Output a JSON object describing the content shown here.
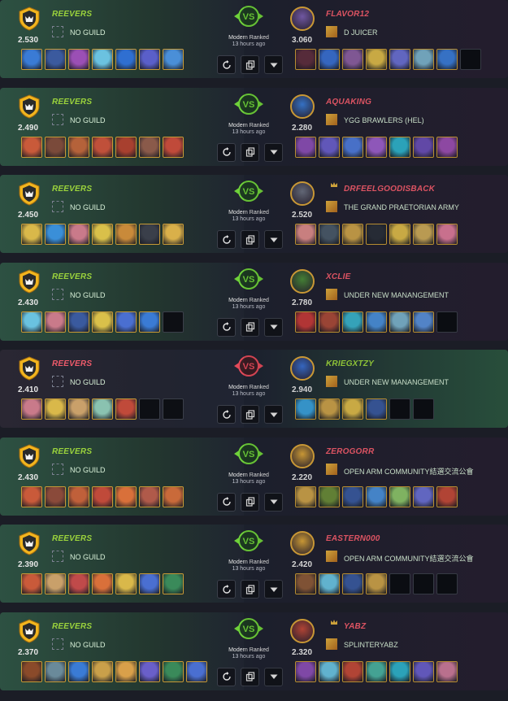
{
  "player": {
    "name": "REEVERS",
    "guild": "NO GUILD"
  },
  "battles": [
    {
      "result": "win",
      "player_rating": "2.530",
      "opponent": {
        "name": "FLAVOR12",
        "rating": "3.060",
        "guild": "D JUICER",
        "crown": false,
        "avatar_color": "#7a5fb0"
      },
      "mode": "Modern Ranked",
      "time": "13 hours ago",
      "player_cards": [
        "#3a7bd5",
        "#3b5a9e",
        "#9b4fb5",
        "#6bc2e0",
        "#2f6fd1",
        "#5a5fc9",
        "#4a8fd8"
      ],
      "opponent_cards": [
        "#5e2f3f",
        "#3a6fd0",
        "#8a5fa0",
        "#d9b84a",
        "#6a6fd1",
        "#7ab0c9",
        "#3b7bd5",
        "empty"
      ]
    },
    {
      "result": "win",
      "player_rating": "2.490",
      "opponent": {
        "name": "AQUAKING",
        "rating": "2.280",
        "guild": "YGG BRAWLERS (HEL)",
        "crown": false,
        "avatar_color": "#3a7bd5"
      },
      "mode": "Modern Ranked",
      "time": "13 hours ago",
      "player_cards": [
        "#c95a3a",
        "#7a4a3a",
        "#b5623a",
        "#c0503a",
        "#a8402f",
        "#8a5a4a",
        "#c04a3a"
      ],
      "opponent_cards": [
        "#8a4fb5",
        "#6a5fc9",
        "#4f7ad8",
        "#9b5fc9",
        "#2fb0c9",
        "#6a4fb5",
        "#9a4fb0"
      ]
    },
    {
      "result": "win",
      "player_rating": "2.450",
      "opponent": {
        "name": "DRFEELGOODISBACK",
        "rating": "2.520",
        "guild": "THE GRAND PRAETORIAN ARMY",
        "crown": true,
        "avatar_color": "#6a7080"
      },
      "mode": "Modern Ranked",
      "time": "13 hours ago",
      "player_cards": [
        "#d9b84a",
        "#3a8fd8",
        "#c97a8a",
        "#d9c04a",
        "#c98a3a",
        "#3a3f4a",
        "#d9b04a"
      ],
      "opponent_cards": [
        "#d98a8a",
        "#4a5a6a",
        "#c9a04a",
        "#2a2f3a",
        "#d9b84a",
        "#c9a85a",
        "#d97a9a"
      ]
    },
    {
      "result": "win",
      "player_rating": "2.430",
      "opponent": {
        "name": "XCLIE",
        "rating": "2.780",
        "guild": "UNDER NEW MANANGEMENT",
        "crown": false,
        "avatar_color": "#4a8a3a"
      },
      "mode": "Modern Ranked",
      "time": "13 hours ago",
      "player_cards": [
        "#6ac2e0",
        "#c97a8a",
        "#3a5a9e",
        "#d9c04a",
        "#4a6fd1",
        "#3a7bd5",
        "empty"
      ],
      "opponent_cards": [
        "#c03a3a",
        "#a84a3a",
        "#3ab0c9",
        "#4a8fd8",
        "#7ab0c9",
        "#5a8fd8",
        "empty"
      ]
    },
    {
      "result": "loss",
      "player_rating": "2.410",
      "opponent": {
        "name": "KRIEGXTZY",
        "rating": "2.940",
        "guild": "UNDER NEW MANANGEMENT",
        "crown": false,
        "avatar_color": "#3a6fd0"
      },
      "mode": "Modern Ranked",
      "time": "13 hours ago",
      "player_cards": [
        "#c97a8a",
        "#d9b84a",
        "#c9a06a",
        "#8ac2b0",
        "#c04a3a",
        "empty",
        "empty"
      ],
      "opponent_cards": [
        "#3a9fd8",
        "#c9a04a",
        "#d9b84a",
        "#3a5a9e",
        "empty",
        "empty"
      ]
    },
    {
      "result": "win",
      "player_rating": "2.430",
      "opponent": {
        "name": "ZEROGORR",
        "rating": "2.220",
        "guild": "OPEN ARM COMMUNITY結選交流公會",
        "crown": false,
        "avatar_color": "#d9a43a"
      },
      "mode": "Modern Ranked",
      "time": "13 hours ago",
      "player_cards": [
        "#c95a3a",
        "#8a4a3a",
        "#c0603a",
        "#c04a3a",
        "#d9703a",
        "#b05a4a",
        "#c96a3a"
      ],
      "opponent_cards": [
        "#c9a04a",
        "#6a8a3a",
        "#3a5a9e",
        "#4a8fd8",
        "#8ac26a",
        "#6a6fd1",
        "#c04a3a"
      ]
    },
    {
      "result": "win",
      "player_rating": "2.390",
      "opponent": {
        "name": "EASTERN000",
        "rating": "2.420",
        "guild": "OPEN ARM COMMUNITY結選交流公會",
        "crown": false,
        "avatar_color": "#d9a43a"
      },
      "mode": "Modern Ranked",
      "time": "13 hours ago",
      "player_cards": [
        "#c95a3a",
        "#c9a06a",
        "#c04a4a",
        "#d9703a",
        "#d9b84a",
        "#4a6fd1",
        "#3a8a5a"
      ],
      "opponent_cards": [
        "#8a5a3a",
        "#6ac2e0",
        "#3a5a9e",
        "#c9a04a",
        "empty",
        "empty",
        "empty"
      ]
    },
    {
      "result": "win",
      "player_rating": "2.370",
      "opponent": {
        "name": "YABZ",
        "rating": "2.320",
        "guild": "SPLINTERYABZ",
        "crown": true,
        "avatar_color": "#c04a3a"
      },
      "mode": "Modern Ranked",
      "time": "13 hours ago",
      "player_cards": [
        "#8a4a2a",
        "#6a8a9a",
        "#3a7bd5",
        "#c9a04a",
        "#d9a04a",
        "#6a5fc9",
        "#3a8a5a",
        "#4a6fd1"
      ],
      "opponent_cards": [
        "#8a4fb5",
        "#6ac2e0",
        "#c04a3a",
        "#4ab0a0",
        "#2fb0c9",
        "#6a5fc9",
        "#c97a9a"
      ]
    }
  ]
}
